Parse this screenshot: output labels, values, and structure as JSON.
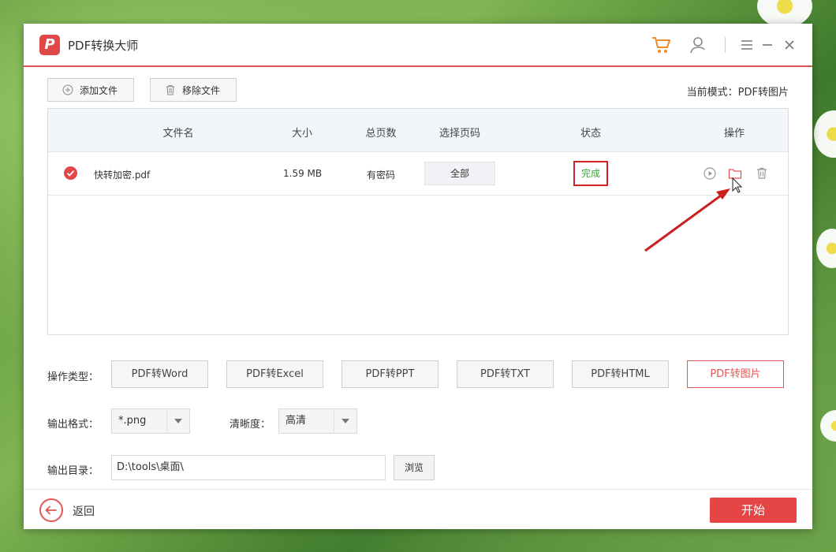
{
  "app": {
    "title": "PDF转换大师",
    "logo_letter": "P"
  },
  "toolbar": {
    "add_file_label": "添加文件",
    "remove_file_label": "移除文件",
    "mode_text": "当前模式：PDF转图片"
  },
  "table": {
    "headers": [
      "文件名",
      "大小",
      "总页数",
      "选择页码",
      "状态",
      "操作"
    ],
    "rows": [
      {
        "name": "快转加密.pdf",
        "size": "1.59 MB",
        "pages": "有密码",
        "page_select": "全部",
        "status": "完成"
      }
    ]
  },
  "options": {
    "type_label": "操作类型：",
    "types": [
      "PDF转Word",
      "PDF转Excel",
      "PDF转PPT",
      "PDF转TXT",
      "PDF转HTML",
      "PDF转图片"
    ],
    "active_type": "PDF转图片",
    "format_label": "输出格式：",
    "format_value": "*.png",
    "clarity_label": "清晰度：",
    "clarity_value": "高清",
    "output_label": "输出目录：",
    "output_path": "D:\\tools\\桌面\\",
    "browse_label": "浏览"
  },
  "footer": {
    "back_label": "返回",
    "start_label": "开始"
  },
  "colors": {
    "accent": "#e25555",
    "status_done": "#39a83c",
    "highlight_box": "#d42020"
  }
}
